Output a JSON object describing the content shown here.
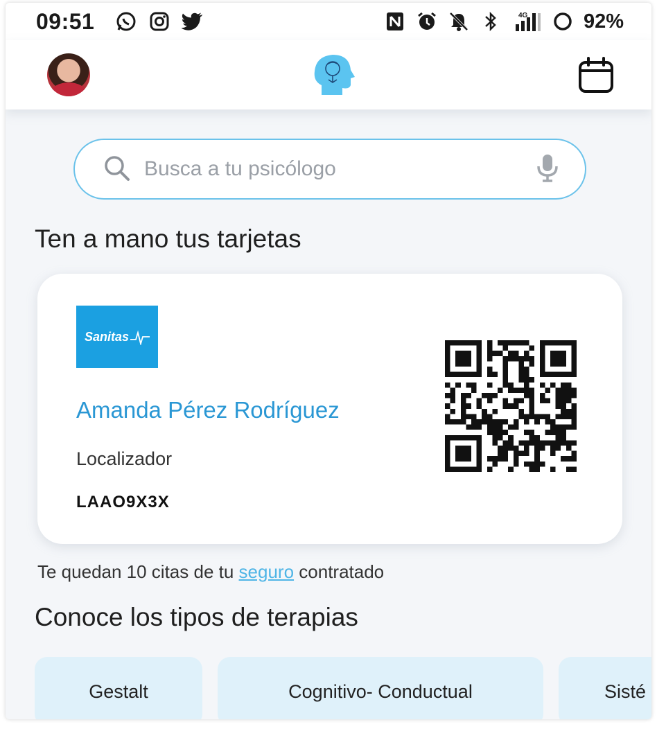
{
  "status_bar": {
    "time": "09:51",
    "battery": "92%",
    "left_icons": [
      "whatsapp-icon",
      "instagram-icon",
      "twitter-icon"
    ],
    "right_icons": [
      "nfc-icon",
      "alarm-icon",
      "mute-icon",
      "bluetooth-icon",
      "signal-4g-icon",
      "battery-icon"
    ],
    "network": "4G"
  },
  "header": {
    "logo_icon": "head-mind-icon",
    "calendar_icon": "calendar-icon"
  },
  "search": {
    "placeholder": "Busca a tu psicólogo"
  },
  "cards_section": {
    "title": "Ten a mano tus tarjetas"
  },
  "card": {
    "insurer": "Sanitas",
    "holder_name": "Amanda Pérez Rodríguez",
    "locator_label": "Localizador",
    "locator_value": "LAAO9X3X"
  },
  "remaining": {
    "prefix": "Te quedan 10 citas de tu ",
    "link": "seguro",
    "suffix": " contratado"
  },
  "therapies_section": {
    "title": "Conoce los tipos de terapias",
    "items": [
      "Gestalt",
      "Cognitivo- Conductual",
      "Sisté"
    ]
  },
  "colors": {
    "accent": "#2a97d4",
    "search_border": "#6bc2ea",
    "chip_bg": "#dff1fa",
    "insurer_brand": "#1ba0e1"
  }
}
